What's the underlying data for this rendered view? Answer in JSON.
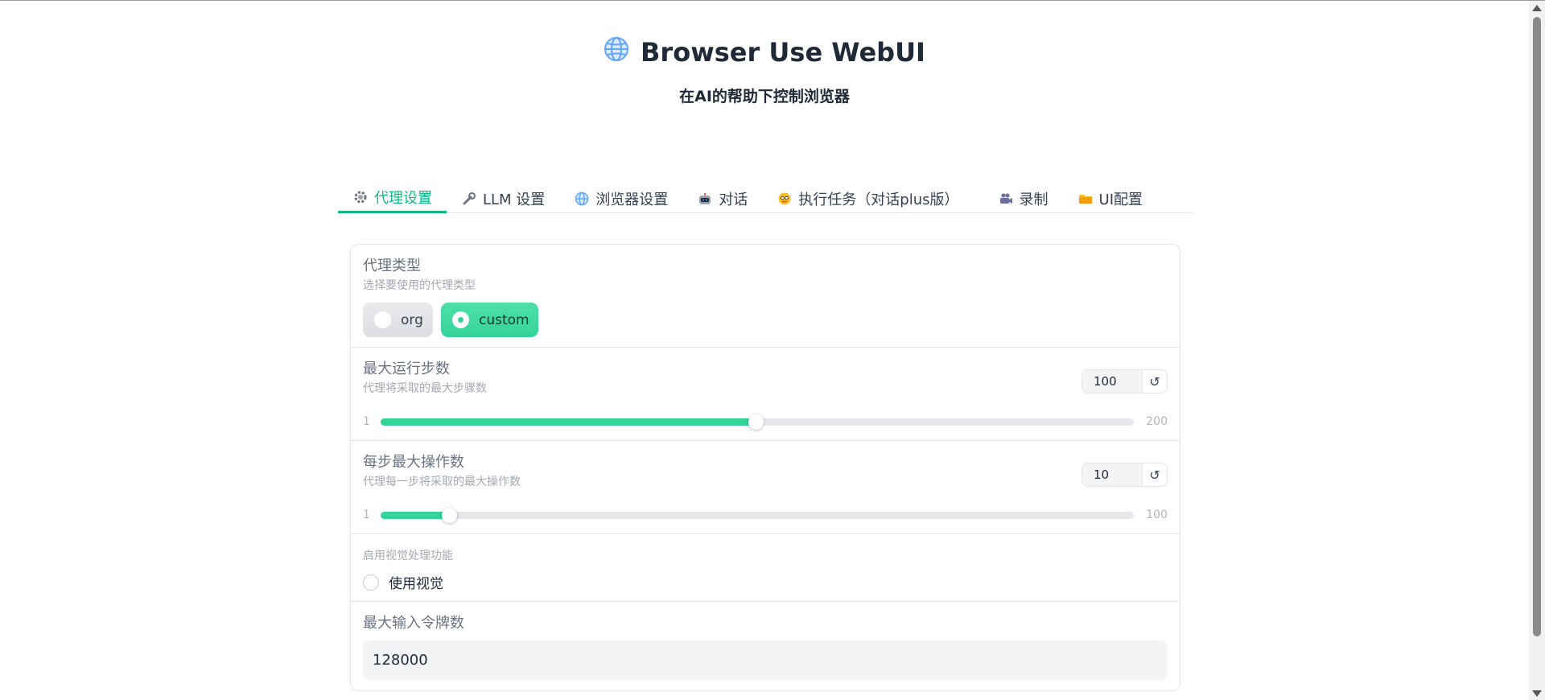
{
  "header": {
    "title": "Browser Use WebUI",
    "subtitle": "在AI的帮助下控制浏览器",
    "title_icon": "globe-icon"
  },
  "tabs": [
    {
      "label": "代理设置",
      "icon": "gear-icon",
      "active": true
    },
    {
      "label": "LLM 设置",
      "icon": "wrench-icon",
      "active": false
    },
    {
      "label": "浏览器设置",
      "icon": "globe-icon",
      "active": false
    },
    {
      "label": "对话",
      "icon": "robot-icon",
      "active": false
    },
    {
      "label": "执行任务（对话plus版）",
      "icon": "face-icon",
      "active": false
    },
    {
      "label": "录制",
      "icon": "video-camera-icon",
      "active": false
    },
    {
      "label": "UI配置",
      "icon": "folder-icon",
      "active": false
    }
  ],
  "agent_type": {
    "label": "代理类型",
    "info": "选择要使用的代理类型",
    "options": [
      "org",
      "custom"
    ],
    "selected": "custom"
  },
  "max_steps": {
    "label": "最大运行步数",
    "info": "代理将采取的最大步骤数",
    "value": "100",
    "min": "1",
    "max": "200",
    "fraction": 0.4975,
    "reset_glyph": "↺"
  },
  "max_actions": {
    "label": "每步最大操作数",
    "info": "代理每一步将采取的最大操作数",
    "value": "10",
    "min": "1",
    "max": "100",
    "fraction": 0.0909,
    "reset_glyph": "↺"
  },
  "vision": {
    "label": "启用视觉处理功能",
    "checkbox_label": "使用视觉",
    "checked": false
  },
  "max_tokens": {
    "label": "最大输入令牌数",
    "value": "128000"
  },
  "colors": {
    "accent": "#10b981",
    "slider_fill": "#34d399",
    "pill_selected": "#34d399"
  }
}
